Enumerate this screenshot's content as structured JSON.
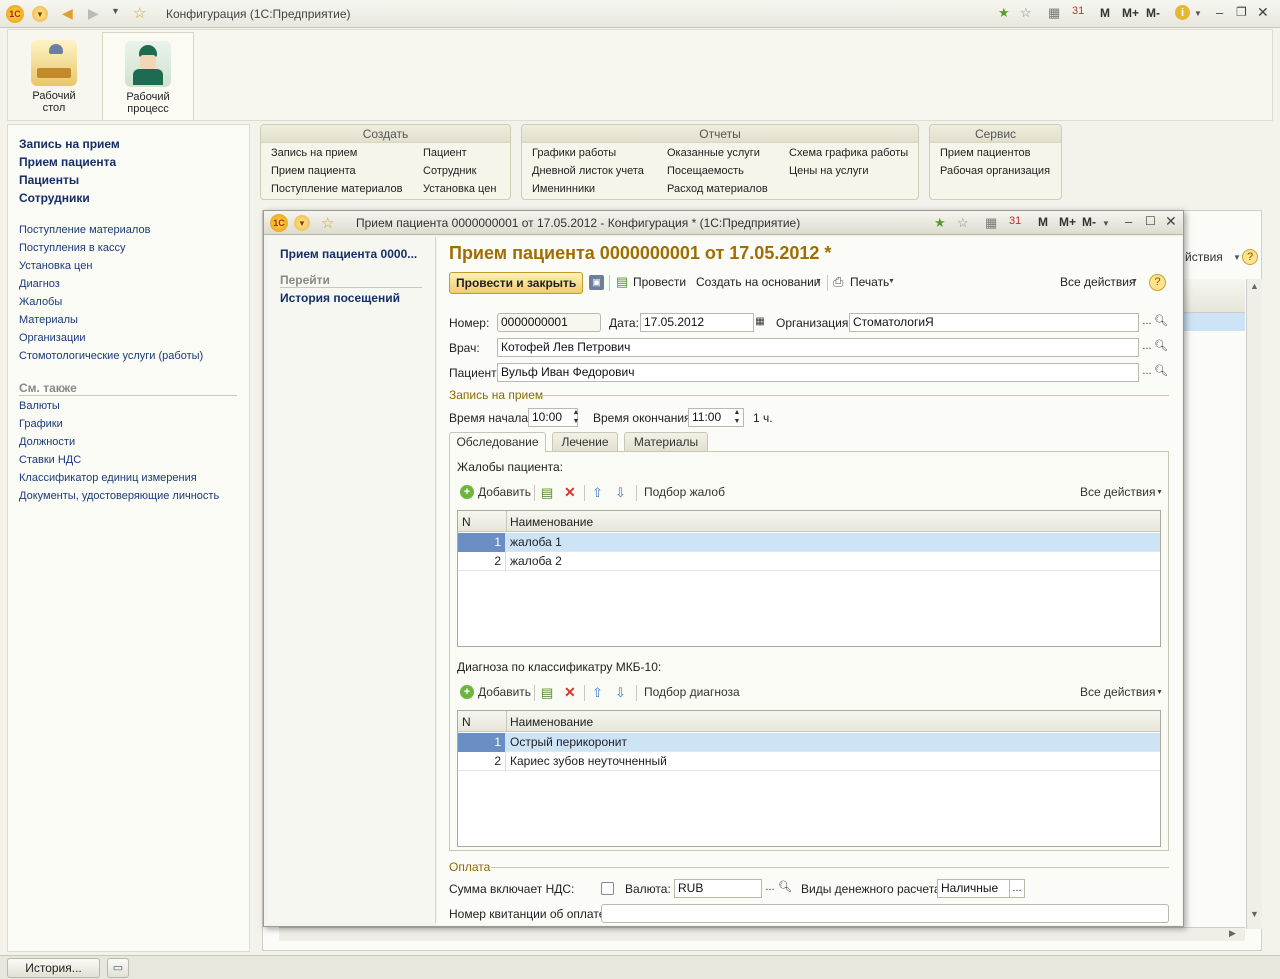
{
  "app": {
    "title": "Конфигурация  (1С:Предприятие)",
    "toolbar_m": "M",
    "toolbar_mplus": "M+",
    "toolbar_mminus": "M-"
  },
  "sections": [
    {
      "label": "Рабочий стол"
    },
    {
      "label": "Рабочий процесс"
    }
  ],
  "leftnav": {
    "main_links": [
      "Запись на прием",
      "Прием пациента",
      "Пациенты",
      "Сотрудники"
    ],
    "links": [
      "Поступление материалов",
      "Поступления в кассу",
      "Установка цен",
      "Диагноз",
      "Жалобы",
      "Материалы",
      "Организации",
      "Стомотологические услуги (работы)"
    ],
    "see_also_title": "См. также",
    "see_also": [
      "Валюты",
      "Графики",
      "Должности",
      "Ставки НДС",
      "Классификатор единиц измерения",
      "Документы, удостоверяющие личность"
    ]
  },
  "command_groups": [
    {
      "title": "Создать",
      "items": [
        "Запись на прием",
        "Прием пациента",
        "Поступление материалов",
        "Пациент",
        "Сотрудник",
        "Установка цен"
      ]
    },
    {
      "title": "Отчеты",
      "items": [
        "Графики работы",
        "Дневной листок учета",
        "Именинники",
        "Оказанные услуги",
        "Посещаемость",
        "Расход материалов",
        "Схема графика работы",
        "Цены на услуги"
      ]
    },
    {
      "title": "Сервис",
      "items": [
        "Прием пациентов",
        "Рабочая организация"
      ]
    }
  ],
  "bg_panel": {
    "actions_label": "йствия"
  },
  "modal": {
    "window_title": "Прием пациента 0000000001 от 17.05.2012 - Конфигурация * (1С:Предприятие)",
    "sidebar": {
      "current": "Прием пациента 0000...",
      "goto_title": "Перейти",
      "history": "История посещений"
    },
    "heading": "Прием пациента 0000000001 от 17.05.2012 *",
    "toolbar": {
      "post_close": "Провести и закрыть",
      "post": "Провести",
      "create_based": "Создать на основании",
      "print": "Печать",
      "all_actions": "Все действия"
    },
    "fields": {
      "number_label": "Номер:",
      "number": "0000000001",
      "date_label": "Дата:",
      "date": "17.05.2012",
      "org_label": "Организация:",
      "org": "СтоматологиЯ",
      "doctor_label": "Врач:",
      "doctor": "Котофей Лев Петрович",
      "patient_label": "Пациент:",
      "patient": "Вульф Иван Федорович"
    },
    "appointment": {
      "title": "Запись на прием",
      "start_label": "Время начала:",
      "start": "10:00",
      "end_label": "Время окончания:",
      "end": "11:00",
      "duration": "1 ч."
    },
    "tabs": [
      "Обследование",
      "Лечение",
      "Материалы"
    ],
    "complaints": {
      "title": "Жалобы пациента:",
      "add": "Добавить",
      "pick": "Подбор жалоб",
      "all_actions": "Все действия",
      "col_n": "N",
      "col_name": "Наименование",
      "rows": [
        {
          "n": "1",
          "name": "жалоба 1"
        },
        {
          "n": "2",
          "name": "жалоба 2"
        }
      ]
    },
    "diagnosis": {
      "title": "Диагноза по классификатру МКБ-10:",
      "add": "Добавить",
      "pick": "Подбор диагноза",
      "all_actions": "Все действия",
      "col_n": "N",
      "col_name": "Наименование",
      "rows": [
        {
          "n": "1",
          "name": "Острый перикоронит"
        },
        {
          "n": "2",
          "name": "Кариес зубов неуточненный"
        }
      ]
    },
    "payment": {
      "title": "Оплата",
      "vat_label": "Сумма включает НДС:",
      "vat_checked": false,
      "currency_label": "Валюта:",
      "currency": "RUB",
      "cash_type_label": "Виды денежного расчета:",
      "cash_type": "Наличные",
      "receipt_label": "Номер квитанции об оплате:",
      "receipt": ""
    }
  },
  "statusbar": {
    "history": "История..."
  }
}
